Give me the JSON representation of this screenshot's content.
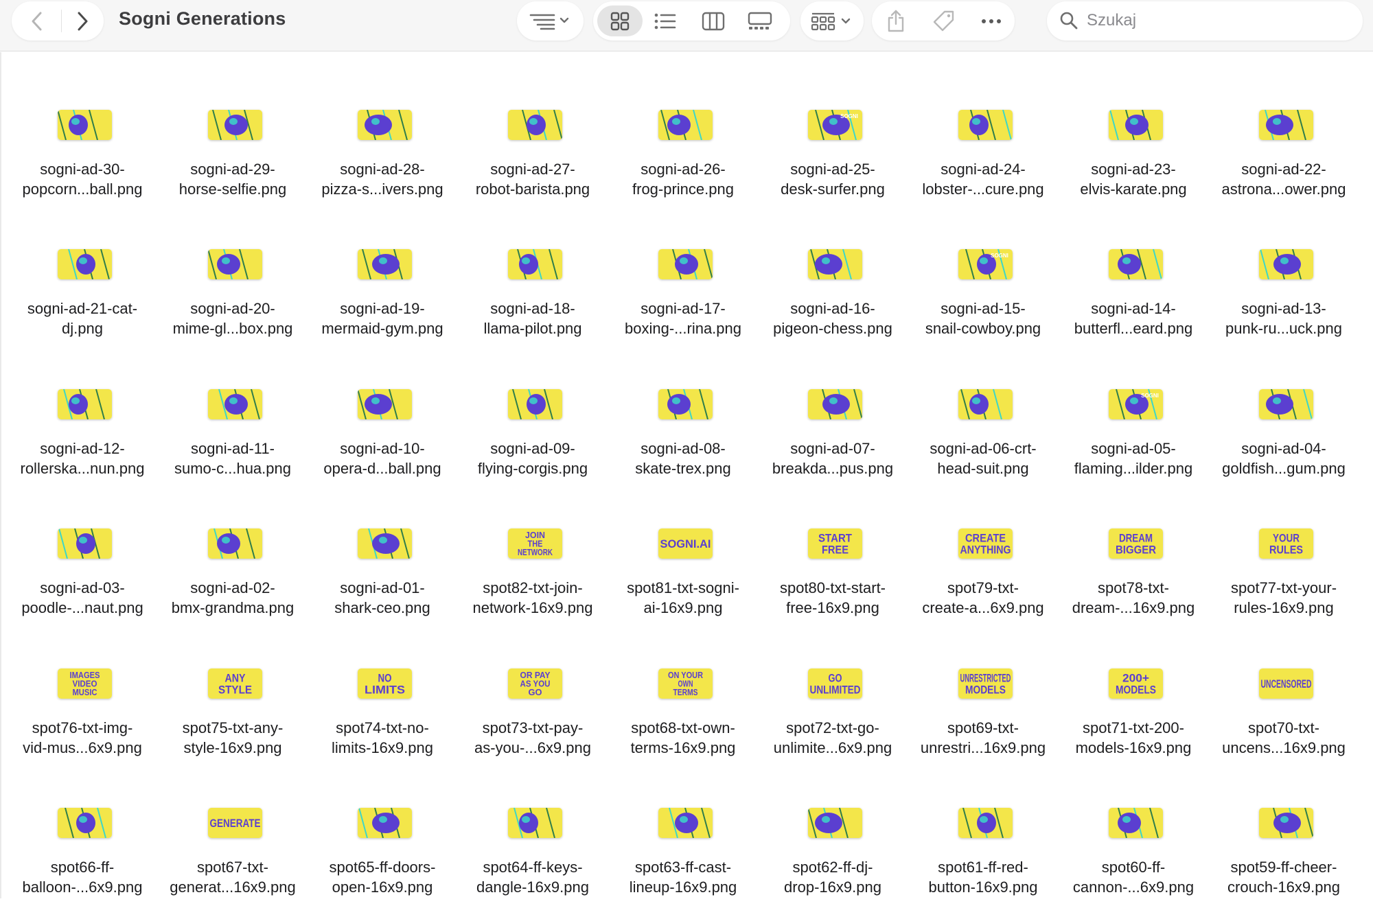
{
  "window": {
    "title": "Sogni Generations"
  },
  "search": {
    "placeholder": "Szukaj"
  },
  "toolbar": {
    "icons": [
      "chevron-left-icon",
      "chevron-right-icon",
      "sort-list-icon",
      "grid-view-icon",
      "list-view-icon",
      "columns-view-icon",
      "gallery-view-icon",
      "group-icon",
      "share-icon",
      "tag-icon",
      "more-icon",
      "search-icon"
    ]
  },
  "colors": {
    "thumb_yellow": "#f3e64a",
    "thumb_purple": "#5b3fd0",
    "thumb_cyan": "#3dd6c8",
    "toolbar_bg": "#f6f6f6"
  },
  "files": [
    {
      "line1": "sogni-ad-30-",
      "line2": "popcorn...ball.png",
      "kind": "yellow"
    },
    {
      "line1": "sogni-ad-29-",
      "line2": "horse-selfie.png",
      "kind": "yellow"
    },
    {
      "line1": "sogni-ad-28-",
      "line2": "pizza-s...ivers.png",
      "kind": "yellow"
    },
    {
      "line1": "sogni-ad-27-",
      "line2": "robot-barista.png",
      "kind": "yellow"
    },
    {
      "line1": "sogni-ad-26-",
      "line2": "frog-prince.png",
      "kind": "yellow"
    },
    {
      "line1": "sogni-ad-25-",
      "line2": "desk-surfer.png",
      "kind": "yellow",
      "badge": "SOGNI"
    },
    {
      "line1": "sogni-ad-24-",
      "line2": "lobster-...cure.png",
      "kind": "yellow"
    },
    {
      "line1": "sogni-ad-23-",
      "line2": "elvis-karate.png",
      "kind": "yellow"
    },
    {
      "line1": "sogni-ad-22-",
      "line2": "astrona...ower.png",
      "kind": "yellow"
    },
    {
      "line1": "sogni-ad-21-cat-",
      "line2": "dj.png",
      "kind": "yellow"
    },
    {
      "line1": "sogni-ad-20-",
      "line2": "mime-gl...box.png",
      "kind": "yellow"
    },
    {
      "line1": "sogni-ad-19-",
      "line2": "mermaid-gym.png",
      "kind": "yellow"
    },
    {
      "line1": "sogni-ad-18-",
      "line2": "llama-pilot.png",
      "kind": "yellow"
    },
    {
      "line1": "sogni-ad-17-",
      "line2": "boxing-...rina.png",
      "kind": "yellow"
    },
    {
      "line1": "sogni-ad-16-",
      "line2": "pigeon-chess.png",
      "kind": "yellow"
    },
    {
      "line1": "sogni-ad-15-",
      "line2": "snail-cowboy.png",
      "kind": "yellow",
      "badge": "SOGNI"
    },
    {
      "line1": "sogni-ad-14-",
      "line2": "butterfl...eard.png",
      "kind": "yellow"
    },
    {
      "line1": "sogni-ad-13-",
      "line2": "punk-ru...uck.png",
      "kind": "yellow"
    },
    {
      "line1": "sogni-ad-12-",
      "line2": "rollerska...nun.png",
      "kind": "yellow"
    },
    {
      "line1": "sogni-ad-11-",
      "line2": "sumo-c...hua.png",
      "kind": "yellow"
    },
    {
      "line1": "sogni-ad-10-",
      "line2": "opera-d...ball.png",
      "kind": "yellow"
    },
    {
      "line1": "sogni-ad-09-",
      "line2": "flying-corgis.png",
      "kind": "yellow"
    },
    {
      "line1": "sogni-ad-08-",
      "line2": "skate-trex.png",
      "kind": "yellow"
    },
    {
      "line1": "sogni-ad-07-",
      "line2": "breakda...pus.png",
      "kind": "yellow"
    },
    {
      "line1": "sogni-ad-06-crt-",
      "line2": "head-suit.png",
      "kind": "yellow"
    },
    {
      "line1": "sogni-ad-05-",
      "line2": "flaming...ilder.png",
      "kind": "yellow",
      "badge": "SOGNI"
    },
    {
      "line1": "sogni-ad-04-",
      "line2": "goldfish...gum.png",
      "kind": "yellow"
    },
    {
      "line1": "sogni-ad-03-",
      "line2": "poodle-...naut.png",
      "kind": "yellow"
    },
    {
      "line1": "sogni-ad-02-",
      "line2": "bmx-grandma.png",
      "kind": "yellow"
    },
    {
      "line1": "sogni-ad-01-",
      "line2": "shark-ceo.png",
      "kind": "yellow"
    },
    {
      "line1": "spot82-txt-join-",
      "line2": "network-16x9.png",
      "kind": "text",
      "thumb_text": [
        "JOIN",
        "THE",
        "NETWORK"
      ]
    },
    {
      "line1": "spot81-txt-sogni-",
      "line2": "ai-16x9.png",
      "kind": "text",
      "thumb_text": [
        "SOGNI.AI"
      ]
    },
    {
      "line1": "spot80-txt-start-",
      "line2": "free-16x9.png",
      "kind": "text",
      "thumb_text": [
        "START",
        "FREE"
      ]
    },
    {
      "line1": "spot79-txt-",
      "line2": "create-a...6x9.png",
      "kind": "text",
      "thumb_text": [
        "CREATE",
        "ANYTHING"
      ]
    },
    {
      "line1": "spot78-txt-",
      "line2": "dream-...16x9.png",
      "kind": "text",
      "thumb_text": [
        "DREAM",
        "BIGGER"
      ]
    },
    {
      "line1": "spot77-txt-your-",
      "line2": "rules-16x9.png",
      "kind": "text",
      "thumb_text": [
        "YOUR",
        "RULES"
      ]
    },
    {
      "line1": "spot76-txt-img-",
      "line2": "vid-mus...6x9.png",
      "kind": "text",
      "thumb_text": [
        "IMAGES",
        "VIDEO",
        "MUSIC"
      ]
    },
    {
      "line1": "spot75-txt-any-",
      "line2": "style-16x9.png",
      "kind": "text",
      "thumb_text": [
        "ANY",
        "STYLE"
      ]
    },
    {
      "line1": "spot74-txt-no-",
      "line2": "limits-16x9.png",
      "kind": "text",
      "thumb_text": [
        "NO",
        "LIMITS"
      ]
    },
    {
      "line1": "spot73-txt-pay-",
      "line2": "as-you-...6x9.png",
      "kind": "text",
      "thumb_text": [
        "OR PAY",
        "AS YOU",
        "GO"
      ]
    },
    {
      "line1": "spot68-txt-own-",
      "line2": "terms-16x9.png",
      "kind": "text",
      "thumb_text": [
        "ON YOUR",
        "OWN",
        "TERMS"
      ]
    },
    {
      "line1": "spot72-txt-go-",
      "line2": "unlimite...6x9.png",
      "kind": "text",
      "thumb_text": [
        "GO",
        "UNLIMITED"
      ]
    },
    {
      "line1": "spot69-txt-",
      "line2": "unrestri...16x9.png",
      "kind": "text",
      "thumb_text": [
        "UNRESTRICTED",
        "MODELS"
      ]
    },
    {
      "line1": "spot71-txt-200-",
      "line2": "models-16x9.png",
      "kind": "text",
      "thumb_text": [
        "200+",
        "MODELS"
      ]
    },
    {
      "line1": "spot70-txt-",
      "line2": "uncens...16x9.png",
      "kind": "text",
      "thumb_text": [
        "UNCENSORED"
      ]
    },
    {
      "line1": "spot66-ff-",
      "line2": "balloon-...6x9.png",
      "kind": "yellow"
    },
    {
      "line1": "spot67-txt-",
      "line2": "generat...16x9.png",
      "kind": "text",
      "thumb_text": [
        "GENERATE"
      ]
    },
    {
      "line1": "spot65-ff-doors-",
      "line2": "open-16x9.png",
      "kind": "yellow"
    },
    {
      "line1": "spot64-ff-keys-",
      "line2": "dangle-16x9.png",
      "kind": "yellow"
    },
    {
      "line1": "spot63-ff-cast-",
      "line2": "lineup-16x9.png",
      "kind": "yellow"
    },
    {
      "line1": "spot62-ff-dj-",
      "line2": "drop-16x9.png",
      "kind": "yellow"
    },
    {
      "line1": "spot61-ff-red-",
      "line2": "button-16x9.png",
      "kind": "yellow"
    },
    {
      "line1": "spot60-ff-",
      "line2": "cannon-...6x9.png",
      "kind": "yellow"
    },
    {
      "line1": "spot59-ff-cheer-",
      "line2": "crouch-16x9.png",
      "kind": "yellow"
    }
  ]
}
